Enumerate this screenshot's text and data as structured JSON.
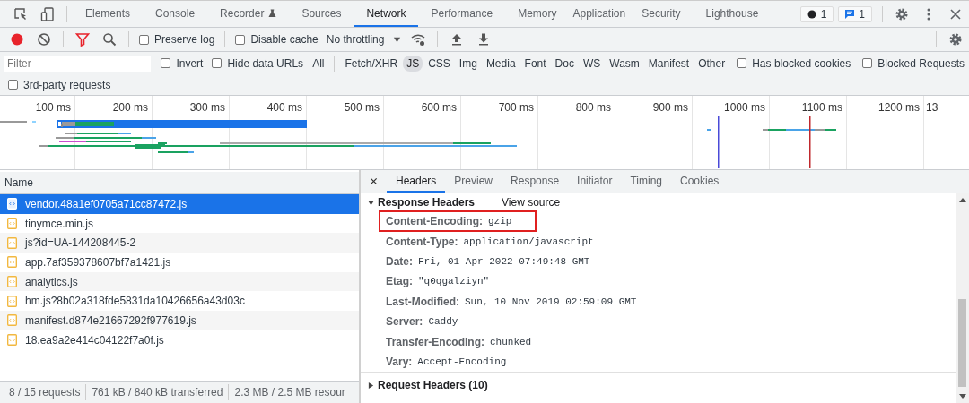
{
  "devtools_tabs": [
    {
      "label": "Elements",
      "selected": false
    },
    {
      "label": "Console",
      "selected": false
    },
    {
      "label": "Recorder",
      "selected": false
    },
    {
      "label": "Sources",
      "selected": false
    },
    {
      "label": "Network",
      "selected": true
    },
    {
      "label": "Performance",
      "selected": false
    },
    {
      "label": "Memory",
      "selected": false
    },
    {
      "label": "Application",
      "selected": false
    },
    {
      "label": "Security",
      "selected": false
    },
    {
      "label": "Lighthouse",
      "selected": false
    }
  ],
  "badges": [
    {
      "kind": "error",
      "count": "1"
    },
    {
      "kind": "message",
      "count": "1"
    }
  ],
  "network_toolbar": {
    "checkboxes": [
      {
        "label": "Preserve log",
        "checked": false
      },
      {
        "label": "Disable cache",
        "checked": false
      }
    ],
    "throttling": "No throttling"
  },
  "filter": {
    "placeholder": "Filter",
    "options_before": [
      {
        "label": "Invert",
        "checked": false
      },
      {
        "label": "Hide data URLs",
        "checked": false
      }
    ],
    "types": [
      {
        "label": "All",
        "selected": false
      },
      {
        "label": "Fetch/XHR",
        "selected": false
      },
      {
        "label": "JS",
        "selected": true
      },
      {
        "label": "CSS",
        "selected": false
      },
      {
        "label": "Img",
        "selected": false
      },
      {
        "label": "Media",
        "selected": false
      },
      {
        "label": "Font",
        "selected": false
      },
      {
        "label": "Doc",
        "selected": false
      },
      {
        "label": "WS",
        "selected": false
      },
      {
        "label": "Wasm",
        "selected": false
      },
      {
        "label": "Manifest",
        "selected": false
      },
      {
        "label": "Other",
        "selected": false
      }
    ],
    "options_after": [
      {
        "label": "Has blocked cookies",
        "checked": false
      },
      {
        "label": "Blocked Requests",
        "checked": false
      }
    ],
    "third_party": {
      "label": "3rd-party requests",
      "checked": false
    }
  },
  "timeline": {
    "ticks": [
      "100 ms",
      "200 ms",
      "300 ms",
      "400 ms",
      "500 ms",
      "600 ms",
      "700 ms",
      "800 ms",
      "900 ms",
      "1000 ms",
      "1100 ms",
      "1200 ms",
      "13"
    ]
  },
  "requests": {
    "column": "Name",
    "rows": [
      {
        "name": "vendor.48a1ef0705a71cc87472.js",
        "selected": true
      },
      {
        "name": "tinymce.min.js",
        "selected": false
      },
      {
        "name": "js?id=UA-144208445-2",
        "selected": false
      },
      {
        "name": "app.7af359378607bf7a1421.js",
        "selected": false
      },
      {
        "name": "analytics.js",
        "selected": false
      },
      {
        "name": "hm.js?8b02a318fde5831da10426656a43d03c",
        "selected": false
      },
      {
        "name": "manifest.d874e21667292f977619.js",
        "selected": false
      },
      {
        "name": "18.ea9a2e414c04122f7a0f.js",
        "selected": false
      }
    ]
  },
  "status_bar": [
    "8 / 15 requests",
    "761 kB / 840 kB transferred",
    "2.3 MB / 2.5 MB resour"
  ],
  "details": {
    "tabs": [
      {
        "label": "Headers",
        "selected": true
      },
      {
        "label": "Preview",
        "selected": false
      },
      {
        "label": "Response",
        "selected": false
      },
      {
        "label": "Initiator",
        "selected": false
      },
      {
        "label": "Timing",
        "selected": false
      },
      {
        "label": "Cookies",
        "selected": false
      }
    ],
    "sections": [
      {
        "title": "Response Headers",
        "expanded": true,
        "action": "View source",
        "headers": [
          {
            "name": "Content-Encoding:",
            "value": "gzip",
            "highlighted": true
          },
          {
            "name": "Content-Type:",
            "value": "application/javascript",
            "highlighted": false
          },
          {
            "name": "Date:",
            "value": "Fri, 01 Apr 2022 07:49:48 GMT",
            "highlighted": false
          },
          {
            "name": "Etag:",
            "value": "\"q0qgalziyn\"",
            "highlighted": false
          },
          {
            "name": "Last-Modified:",
            "value": "Sun, 10 Nov 2019 02:59:09 GMT",
            "highlighted": false
          },
          {
            "name": "Server:",
            "value": "Caddy",
            "highlighted": false
          },
          {
            "name": "Transfer-Encoding:",
            "value": "chunked",
            "highlighted": false
          },
          {
            "name": "Vary:",
            "value": "Accept-Encoding",
            "highlighted": false
          }
        ]
      },
      {
        "title": "Request Headers (10)",
        "expanded": false
      }
    ]
  }
}
